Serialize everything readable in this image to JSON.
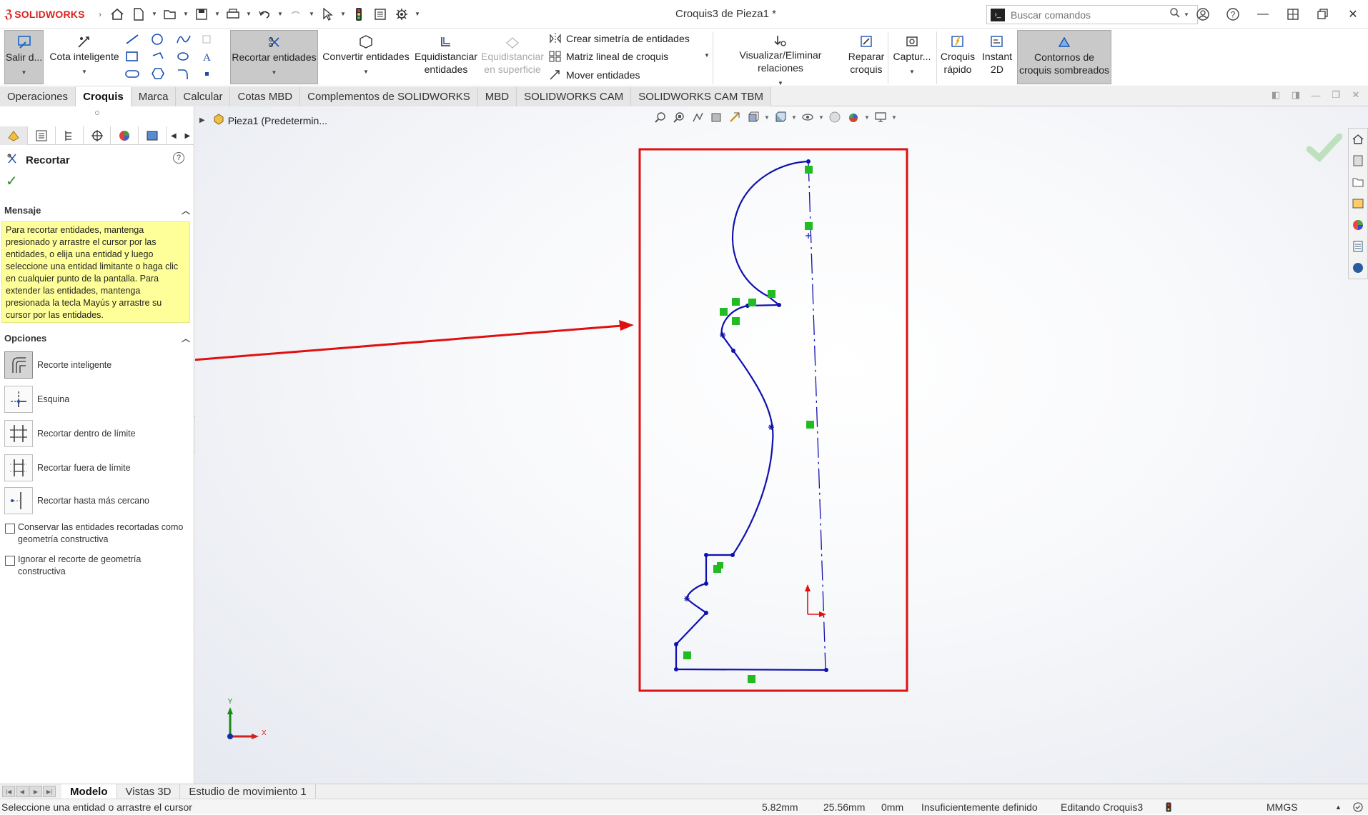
{
  "app": {
    "logo_text": "SOLIDWORKS",
    "window_title": "Croquis3 de Pieza1 *"
  },
  "search": {
    "placeholder": "Buscar comandos"
  },
  "ribbon": {
    "exit_sketch": "Salir d...",
    "smart_dimension": "Cota inteligente",
    "trim_entities": "Recortar entidades",
    "convert_entities": "Convertir entidades",
    "offset_entities_1": "Equidistanciar",
    "offset_entities_2": "entidades",
    "offset_surface_1": "Equidistanciar",
    "offset_surface_2": "en superficie",
    "mirror_entities": "Crear simetría de entidades",
    "linear_pattern": "Matriz lineal de croquis",
    "move_entities": "Mover entidades",
    "display_relations": "Visualizar/Eliminar relaciones",
    "repair_1": "Reparar",
    "repair_2": "croquis",
    "capture": "Captur...",
    "quick_1": "Croquis",
    "quick_2": "rápido",
    "instant_1": "Instant",
    "instant_2": "2D",
    "shaded_1": "Contornos de",
    "shaded_2": "croquis sombreados"
  },
  "tabs": [
    "Operaciones",
    "Croquis",
    "Marca",
    "Calcular",
    "Cotas MBD",
    "Complementos de SOLIDWORKS",
    "MBD",
    "SOLIDWORKS CAM",
    "SOLIDWORKS CAM TBM"
  ],
  "property_manager": {
    "title": "Recortar",
    "message_header": "Mensaje",
    "message": "Para recortar entidades, mantenga presionado y arrastre el cursor por las entidades, o elija una entidad y luego seleccione una entidad limitante o haga clic en cualquier punto de la pantalla. Para extender las entidades, mantenga presionada la tecla Mayús y arrastre su cursor por las entidades.",
    "options_header": "Opciones",
    "options": [
      "Recorte inteligente",
      "Esquina",
      "Recortar dentro de límite",
      "Recortar fuera de límite",
      "Recortar hasta más cercano"
    ],
    "checkbox_1": "Conservar las entidades recortadas como geometría constructiva",
    "checkbox_2": "Ignorar el recorte de geometría constructiva"
  },
  "feature_tree": {
    "root": "Pieza1  (Predetermin..."
  },
  "triad": {
    "x": "X",
    "y": "Y"
  },
  "bottom_tabs": [
    "Modelo",
    "Vistas 3D",
    "Estudio de movimiento 1"
  ],
  "status": {
    "hint": "Seleccione una entidad o arrastre el cursor",
    "x": "5.82mm",
    "y": "25.56mm",
    "z": "0mm",
    "definition": "Insuficientemente definido",
    "editing": "Editando Croquis3",
    "units": "MMGS"
  },
  "colors": {
    "sketch": "#1010b0",
    "annotation": "#e01010",
    "relation": "#22bb22",
    "message_bg": "#ffff99"
  }
}
